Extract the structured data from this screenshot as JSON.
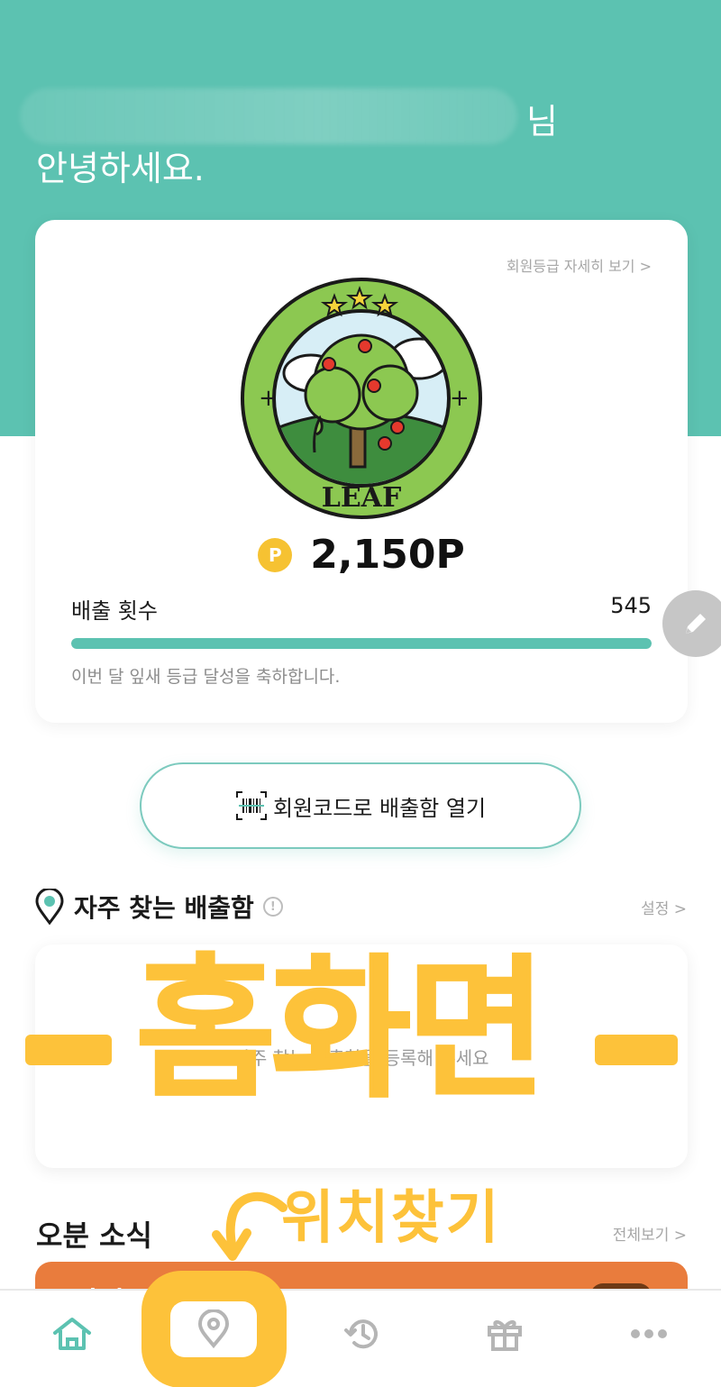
{
  "header": {
    "name_suffix": "님",
    "greeting": "안녕하세요."
  },
  "grade_card": {
    "detail_link": "회원등급 자세히 보기 >",
    "badge_text": "LEAF",
    "points_icon_letter": "P",
    "points": "2,150P",
    "count_label": "배출 횟수",
    "count_value": "545",
    "progress_fraction": 1.0,
    "message": "이번 달 잎새 등급 달성을 축하합니다."
  },
  "code_button": {
    "label": "회원코드로 배출함 열기"
  },
  "favorites": {
    "title": "자주 찾는 배출함",
    "settings": "설정 >",
    "empty_text": "자주 찾는 배출함을 등록해 주세요"
  },
  "news": {
    "title": "오분 소식",
    "see_all": "전체보기 >",
    "banner_snippet": "미리"
  },
  "annotations": {
    "main": "홈화면",
    "sub": "위치찾기"
  },
  "bottom_nav": {
    "items": [
      "home-icon",
      "location-icon",
      "history-icon",
      "gift-icon",
      "more-icon"
    ],
    "active_color": "#5cc2b1",
    "inactive_color": "#b5b5b5"
  },
  "colors": {
    "brand": "#5cc2b1",
    "points_gold": "#f6c232",
    "annotation_yellow": "#fdc23a"
  }
}
